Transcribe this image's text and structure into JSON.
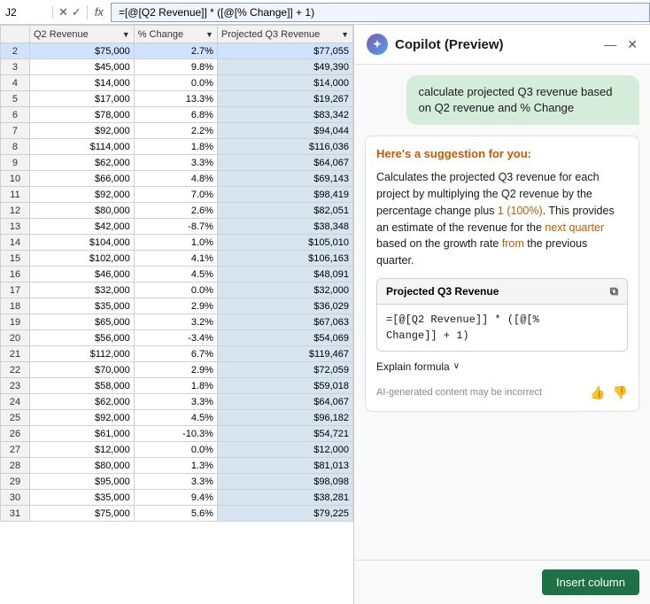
{
  "formulaBar": {
    "cellRef": "J2",
    "formula": "=[@[Q2 Revenue]] * ([@[% Change]] + 1)",
    "fxLabel": "fx"
  },
  "spreadsheet": {
    "columns": {
      "E": "Q2 Revenue",
      "F": "% Change",
      "G": "Projected Q3 Revenue"
    },
    "rows": [
      {
        "num": 2,
        "e": "$75,000",
        "f": "2.7%",
        "g": "$77,055"
      },
      {
        "num": 3,
        "e": "$45,000",
        "f": "9.8%",
        "g": "$49,390"
      },
      {
        "num": 4,
        "e": "$14,000",
        "f": "0.0%",
        "g": "$14,000"
      },
      {
        "num": 5,
        "e": "$17,000",
        "f": "13.3%",
        "g": "$19,267"
      },
      {
        "num": 6,
        "e": "$78,000",
        "f": "6.8%",
        "g": "$83,342"
      },
      {
        "num": 7,
        "e": "$92,000",
        "f": "2.2%",
        "g": "$94,044"
      },
      {
        "num": 8,
        "e": "$114,000",
        "f": "1.8%",
        "g": "$116,036"
      },
      {
        "num": 9,
        "e": "$62,000",
        "f": "3.3%",
        "g": "$64,067"
      },
      {
        "num": 10,
        "e": "$66,000",
        "f": "4.8%",
        "g": "$69,143"
      },
      {
        "num": 11,
        "e": "$92,000",
        "f": "7.0%",
        "g": "$98,419"
      },
      {
        "num": 12,
        "e": "$80,000",
        "f": "2.6%",
        "g": "$82,051"
      },
      {
        "num": 13,
        "e": "$42,000",
        "f": "-8.7%",
        "g": "$38,348"
      },
      {
        "num": 14,
        "e": "$104,000",
        "f": "1.0%",
        "g": "$105,010"
      },
      {
        "num": 15,
        "e": "$102,000",
        "f": "4.1%",
        "g": "$106,163"
      },
      {
        "num": 16,
        "e": "$46,000",
        "f": "4.5%",
        "g": "$48,091"
      },
      {
        "num": 17,
        "e": "$32,000",
        "f": "0.0%",
        "g": "$32,000"
      },
      {
        "num": 18,
        "e": "$35,000",
        "f": "2.9%",
        "g": "$36,029"
      },
      {
        "num": 19,
        "e": "$65,000",
        "f": "3.2%",
        "g": "$67,063"
      },
      {
        "num": 20,
        "e": "$56,000",
        "f": "-3.4%",
        "g": "$54,069"
      },
      {
        "num": 21,
        "e": "$112,000",
        "f": "6.7%",
        "g": "$119,467"
      },
      {
        "num": 22,
        "e": "$70,000",
        "f": "2.9%",
        "g": "$72,059"
      },
      {
        "num": 23,
        "e": "$58,000",
        "f": "1.8%",
        "g": "$59,018"
      },
      {
        "num": 24,
        "e": "$62,000",
        "f": "3.3%",
        "g": "$64,067"
      },
      {
        "num": 25,
        "e": "$92,000",
        "f": "4.5%",
        "g": "$96,182"
      },
      {
        "num": 26,
        "e": "$61,000",
        "f": "-10.3%",
        "g": "$54,721"
      },
      {
        "num": 27,
        "e": "$12,000",
        "f": "0.0%",
        "g": "$12,000"
      },
      {
        "num": 28,
        "e": "$80,000",
        "f": "1.3%",
        "g": "$81,013"
      },
      {
        "num": 29,
        "e": "$95,000",
        "f": "3.3%",
        "g": "$98,098"
      },
      {
        "num": 30,
        "e": "$35,000",
        "f": "9.4%",
        "g": "$38,281"
      },
      {
        "num": 31,
        "e": "$75,000",
        "f": "5.6%",
        "g": "$79,225"
      }
    ]
  },
  "copilot": {
    "title": "Copilot (Preview)",
    "userMessage": "calculate  projected Q3 revenue based on Q2 revenue and % Change",
    "suggestionLabel": "Here's a suggestion for you:",
    "suggestionText": "Calculates the projected Q3 revenue for each project by multiplying the Q2 revenue by the percentage change plus 1 (100%). This provides an estimate of the revenue for the next quarter based on the growth rate from the previous quarter.",
    "formulaCardTitle": "Projected Q3 Revenue",
    "formulaCode": "=[@[Q2 Revenue]] * ([@[%\nChange]] + 1)",
    "explainLabel": "Explain formula",
    "aiDisclaimer": "AI-generated content may be incorrect",
    "insertBtn": "Insert column",
    "thumbUp": "👍",
    "thumbDown": "👎",
    "copyIcon": "⧉",
    "minimizeIcon": "—",
    "closeIcon": "✕"
  }
}
